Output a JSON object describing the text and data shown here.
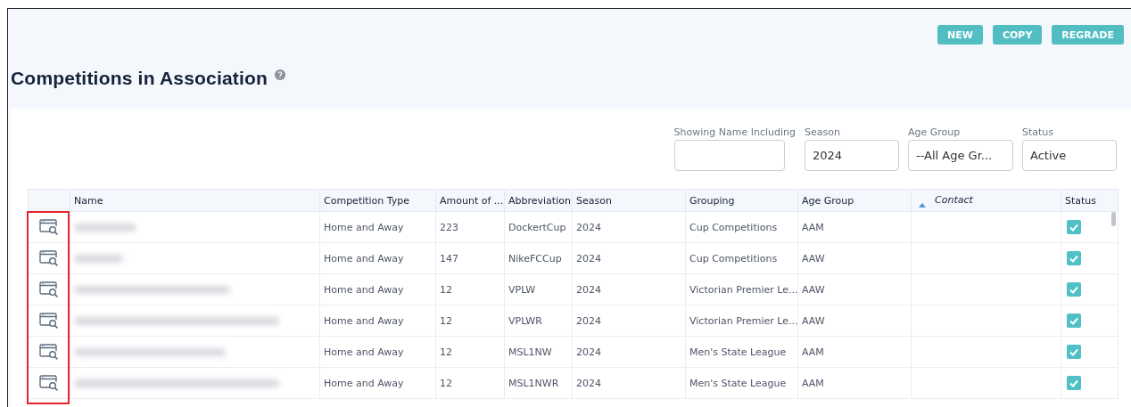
{
  "actions": [
    "NEW",
    "COPY",
    "REGRADE"
  ],
  "page_title": "Competitions in Association",
  "filters": [
    {
      "label": "Showing Name Including"
    },
    {
      "label": "Season",
      "value": "2024"
    },
    {
      "label": "Age Group",
      "value": "--All Age Gr..."
    },
    {
      "label": "Status",
      "value": "Active"
    }
  ],
  "table": {
    "view_column_highlighted": true,
    "columns": [
      {
        "label": "Name",
        "sorted": false
      },
      {
        "label": "Competition Type",
        "sorted": false
      },
      {
        "label": "Amount of ...",
        "sorted": false
      },
      {
        "label": "Abbreviation",
        "sorted": false
      },
      {
        "label": "Season",
        "sorted": false
      },
      {
        "label": "Grouping",
        "sorted": false
      },
      {
        "label": "Age Group",
        "sorted": false
      },
      {
        "label": "Contact",
        "sorted": true
      },
      {
        "label": "Status",
        "sorted": false
      }
    ],
    "rows": [
      {
        "competition_type": "Home and Away",
        "amount": "223",
        "abbreviation": "DockertCup",
        "season": "2024",
        "grouping": "Cup Competitions",
        "age_group": "AAM",
        "status_checked": true
      },
      {
        "competition_type": "Home and Away",
        "amount": "147",
        "abbreviation": "NikeFCCup",
        "season": "2024",
        "grouping": "Cup Competitions",
        "age_group": "AAW",
        "status_checked": true
      },
      {
        "competition_type": "Home and Away",
        "amount": "12",
        "abbreviation": "VPLW",
        "season": "2024",
        "grouping": "Victorian Premier Le...",
        "age_group": "AAW",
        "status_checked": true
      },
      {
        "competition_type": "Home and Away",
        "amount": "12",
        "abbreviation": "VPLWR",
        "season": "2024",
        "grouping": "Victorian Premier Le...",
        "age_group": "AAW",
        "status_checked": true
      },
      {
        "competition_type": "Home and Away",
        "amount": "12",
        "abbreviation": "MSL1NW",
        "season": "2024",
        "grouping": "Men's State League",
        "age_group": "AAM",
        "status_checked": true
      },
      {
        "competition_type": "Home and Away",
        "amount": "12",
        "abbreviation": "MSL1NWR",
        "season": "2024",
        "grouping": "Men's State League",
        "age_group": "AAM",
        "status_checked": true
      }
    ]
  }
}
